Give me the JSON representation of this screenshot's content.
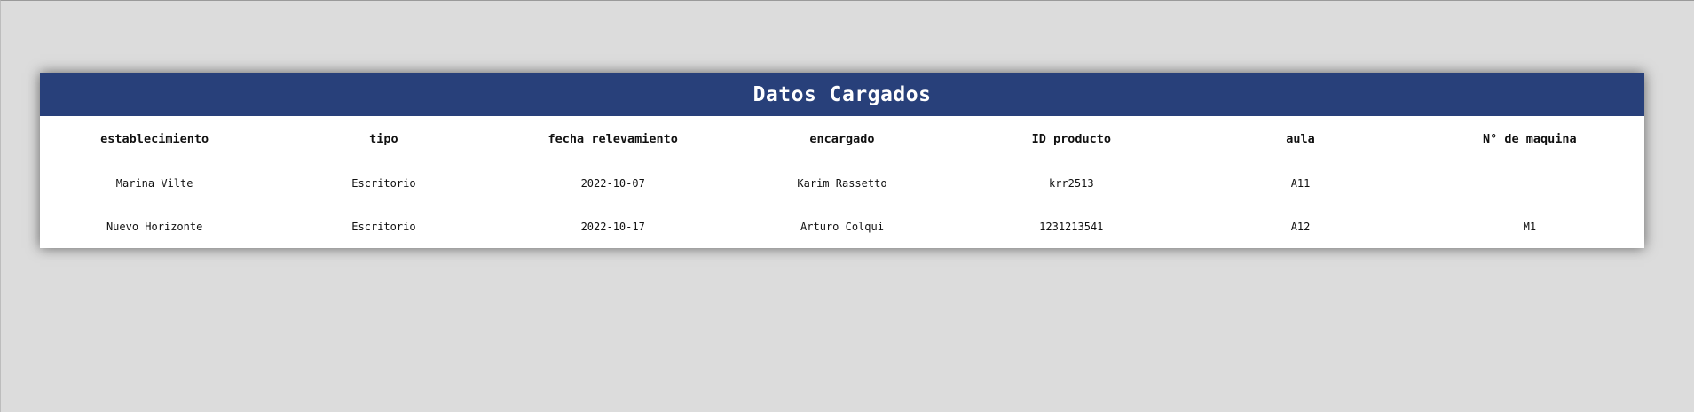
{
  "card": {
    "title": "Datos Cargados"
  },
  "table": {
    "columns": [
      "establecimiento",
      "tipo",
      "fecha relevamiento",
      "encargado",
      "ID producto",
      "aula",
      "N° de maquina"
    ],
    "rows": [
      [
        "Marina Vilte",
        "Escritorio",
        "2022-10-07",
        "Karim Rassetto",
        "krr2513",
        "A11",
        ""
      ],
      [
        "Nuevo Horizonte",
        "Escritorio",
        "2022-10-17",
        "Arturo Colqui",
        "1231213541",
        "A12",
        "M1"
      ]
    ]
  },
  "colors": {
    "page_background": "#dcdcdc",
    "header_background": "#28407a",
    "header_text": "#ffffff",
    "card_background": "#ffffff"
  }
}
